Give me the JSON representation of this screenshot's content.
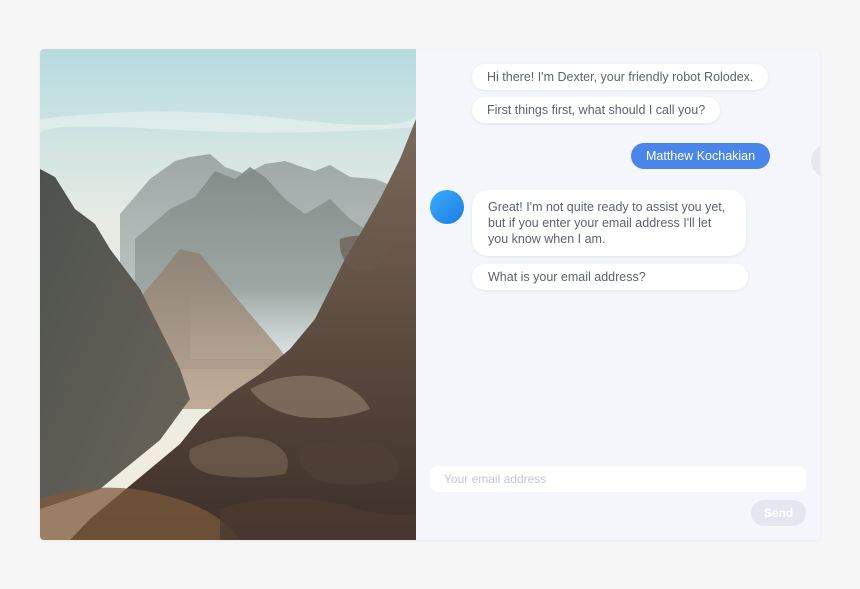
{
  "chat": {
    "messages": [
      {
        "sender": "bot",
        "text": "Hi there! I'm Dexter, your friendly robot Rolodex."
      },
      {
        "sender": "bot",
        "text": "First things first, what should I call you?"
      },
      {
        "sender": "user",
        "text": "Matthew Kochakian"
      },
      {
        "sender": "bot",
        "text": "Great! I'm not quite ready to assist you yet, but if you enter your email address I'll let you know when I am."
      },
      {
        "sender": "bot",
        "text": "What is your email address?"
      }
    ]
  },
  "composer": {
    "placeholder": "Your email address",
    "value": "",
    "send_label": "Send"
  },
  "colors": {
    "accent": "#4a85ea",
    "bot_avatar_gradient": [
      "#38aef8",
      "#1f7ae8"
    ],
    "panel_bg": "#f4f6fb",
    "page_bg": "#f6f6f7",
    "send_disabled": "#e4e7ed"
  },
  "image": {
    "subject": "mountain-landscape-photo"
  }
}
